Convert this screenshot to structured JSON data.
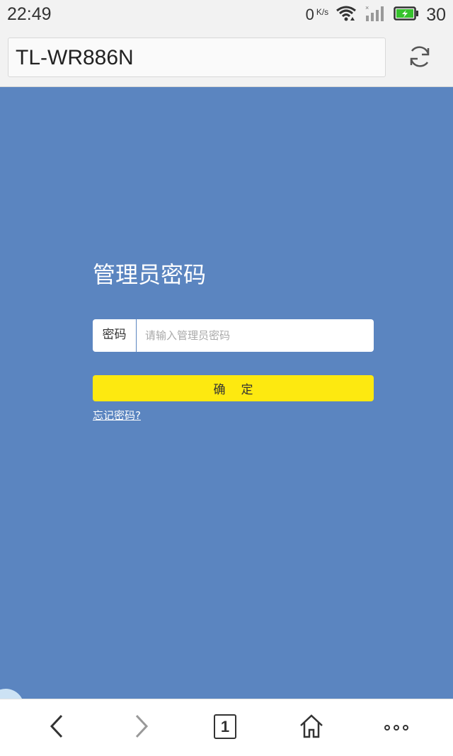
{
  "status_bar": {
    "time": "22:49",
    "net_speed_value": "0",
    "net_speed_unit": "K/s",
    "battery_level": "30",
    "battery_color": "#36c22c"
  },
  "browser": {
    "url": "TL-WR886N",
    "refresh_icon": "refresh-icon"
  },
  "login": {
    "title": "管理员密码",
    "password_label": "密码",
    "password_placeholder": "请输入管理员密码",
    "password_value": "",
    "confirm_label": "确定",
    "forgot_link": "忘记密码?",
    "background_color": "#5b85c0",
    "button_color": "#fde910"
  },
  "bottom_nav": {
    "back_icon": "back-arrow-icon",
    "forward_icon": "forward-arrow-icon",
    "tab_count": "1",
    "home_icon": "home-icon",
    "more_icon": "more-icon"
  }
}
